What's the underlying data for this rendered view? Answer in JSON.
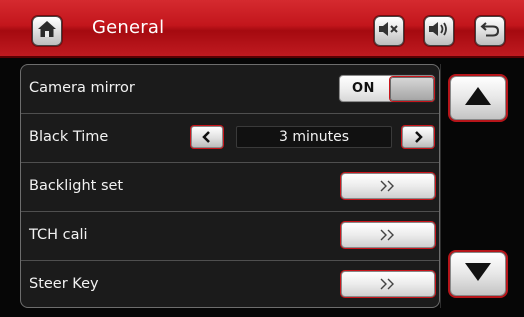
{
  "header": {
    "title": "General",
    "home_icon": "home-icon",
    "mute_icon": "mute-icon",
    "volume_icon": "volume-icon",
    "back_icon": "back-arrow-icon"
  },
  "settings": [
    {
      "label": "Camera mirror",
      "control": "toggle",
      "value": "ON"
    },
    {
      "label": "Black Time",
      "control": "stepper",
      "value": "3 minutes"
    },
    {
      "label": "Backlight set",
      "control": "go",
      "button_text": "»"
    },
    {
      "label": "TCH cali",
      "control": "go",
      "button_text": "»"
    },
    {
      "label": "Steer Key",
      "control": "go",
      "button_text": "»"
    }
  ],
  "scroll": {
    "up_icon": "triangle-up-icon",
    "down_icon": "triangle-down-icon"
  },
  "colors": {
    "header_red": "#c3161c",
    "accent_red": "#c9151b",
    "panel_bg": "#1b1b1b"
  }
}
